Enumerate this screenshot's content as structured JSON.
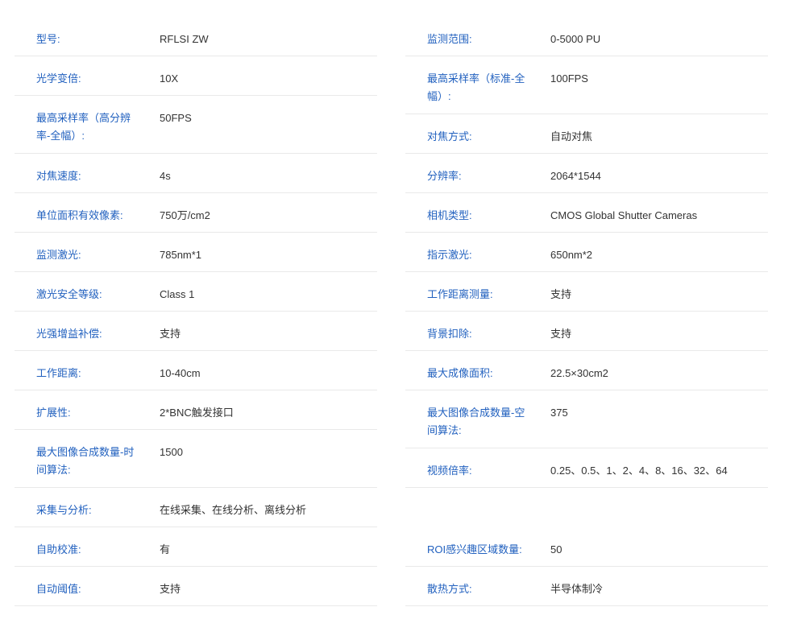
{
  "left": [
    {
      "label": "型号:",
      "value": "RFLSI ZW"
    },
    {
      "label": "光学变倍:",
      "value": "10X"
    },
    {
      "label": "最高采样率（高分辨率-全幅）:",
      "value": "50FPS"
    },
    {
      "label": "对焦速度:",
      "value": "4s"
    },
    {
      "label": "单位面积有效像素:",
      "value": "750万/cm2"
    },
    {
      "label": "监测激光:",
      "value": "785nm*1"
    },
    {
      "label": "激光安全等级:",
      "value": "Class 1"
    },
    {
      "label": "光强增益补偿:",
      "value": "支持"
    },
    {
      "label": "工作距离:",
      "value": "10-40cm"
    },
    {
      "label": "扩展性:",
      "value": "2*BNC触发接口"
    },
    {
      "label": "最大图像合成数量-时间算法:",
      "value": "1500"
    },
    {
      "label": "采集与分析:",
      "value": "在线采集、在线分析、离线分析"
    },
    {
      "label": "自助校准:",
      "value": "有"
    },
    {
      "label": "自动阈值:",
      "value": "支持"
    }
  ],
  "right": [
    {
      "label": "监测范围:",
      "value": "0-5000 PU"
    },
    {
      "label": "最高采样率（标准-全幅）:",
      "value": "100FPS"
    },
    {
      "label": "对焦方式:",
      "value": "自动对焦"
    },
    {
      "label": "分辨率:",
      "value": "2064*1544"
    },
    {
      "label": "相机类型:",
      "value": "CMOS Global Shutter Cameras"
    },
    {
      "label": "指示激光:",
      "value": "650nm*2"
    },
    {
      "label": "工作距离测量:",
      "value": "支持"
    },
    {
      "label": "背景扣除:",
      "value": "支持"
    },
    {
      "label": "最大成像面积:",
      "value": "22.5×30cm2"
    },
    {
      "label": "最大图像合成数量-空间算法:",
      "value": "375"
    },
    {
      "label": "视频倍率:",
      "value": "0.25、0.5、1、2、4、8、16、32、64"
    },
    {
      "label": "ROI感兴趣区域数量:",
      "value": "50"
    },
    {
      "label": "散热方式:",
      "value": "半导体制冷"
    }
  ]
}
